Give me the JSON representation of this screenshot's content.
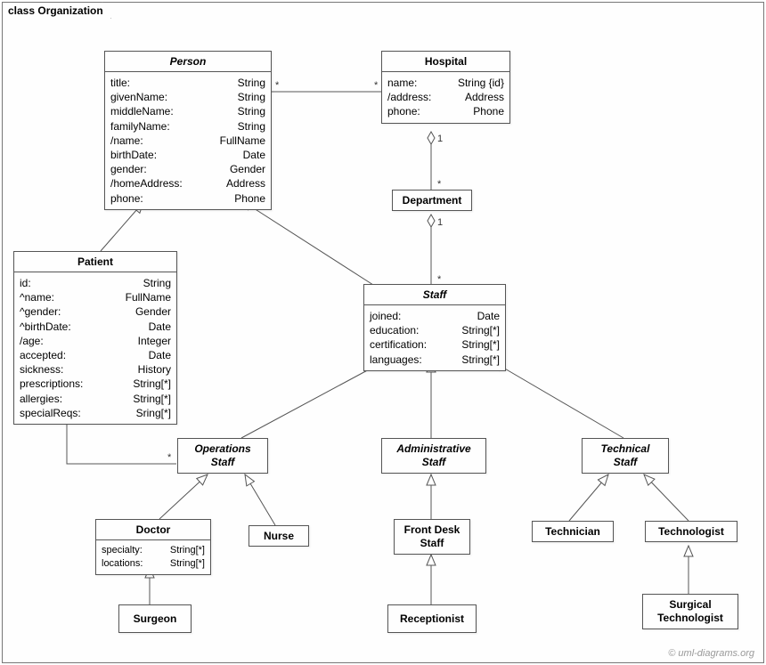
{
  "frame_label": "class Organization",
  "watermark": "© uml-diagrams.org",
  "classes": {
    "person": {
      "name": "Person",
      "attrs": [
        [
          "title:",
          "String"
        ],
        [
          "givenName:",
          "String"
        ],
        [
          "middleName:",
          "String"
        ],
        [
          "familyName:",
          "String"
        ],
        [
          "/name:",
          "FullName"
        ],
        [
          "birthDate:",
          "Date"
        ],
        [
          "gender:",
          "Gender"
        ],
        [
          "/homeAddress:",
          "Address"
        ],
        [
          "phone:",
          "Phone"
        ]
      ]
    },
    "hospital": {
      "name": "Hospital",
      "attrs": [
        [
          "name:",
          "String {id}"
        ],
        [
          "/address:",
          "Address"
        ],
        [
          "phone:",
          "Phone"
        ]
      ]
    },
    "department": {
      "name": "Department"
    },
    "patient": {
      "name": "Patient",
      "attrs": [
        [
          "id:",
          "String"
        ],
        [
          "^name:",
          "FullName"
        ],
        [
          "^gender:",
          "Gender"
        ],
        [
          "^birthDate:",
          "Date"
        ],
        [
          "/age:",
          "Integer"
        ],
        [
          "accepted:",
          "Date"
        ],
        [
          "sickness:",
          "History"
        ],
        [
          "prescriptions:",
          "String[*]"
        ],
        [
          "allergies:",
          "String[*]"
        ],
        [
          "specialReqs:",
          "Sring[*]"
        ]
      ]
    },
    "staff": {
      "name": "Staff",
      "attrs": [
        [
          "joined:",
          "Date"
        ],
        [
          "education:",
          "String[*]"
        ],
        [
          "certification:",
          "String[*]"
        ],
        [
          "languages:",
          "String[*]"
        ]
      ]
    },
    "opstaff": {
      "name": "OperationsStaff"
    },
    "adminstaff": {
      "name": "AdministrativeStaff"
    },
    "techstaff": {
      "name": "TechnicalStaff"
    },
    "doctor": {
      "name": "Doctor",
      "attrs": [
        [
          "specialty:",
          "String[*]"
        ],
        [
          "locations:",
          "String[*]"
        ]
      ]
    },
    "nurse": {
      "name": "Nurse"
    },
    "frontdesk": {
      "name": "Front DeskStaff"
    },
    "receptionist": {
      "name": "Receptionist"
    },
    "technician": {
      "name": "Technician"
    },
    "technologist": {
      "name": "Technologist"
    },
    "surgtech": {
      "name": "SurgicalTechnologist"
    },
    "surgeon": {
      "name": "Surgeon"
    }
  },
  "mult": {
    "ph_star1": "*",
    "ph_star2": "*",
    "hd_one": "1",
    "hd_star": "*",
    "ds_one": "1",
    "ds_star": "*",
    "po_star1": "*",
    "po_star2": "*"
  }
}
